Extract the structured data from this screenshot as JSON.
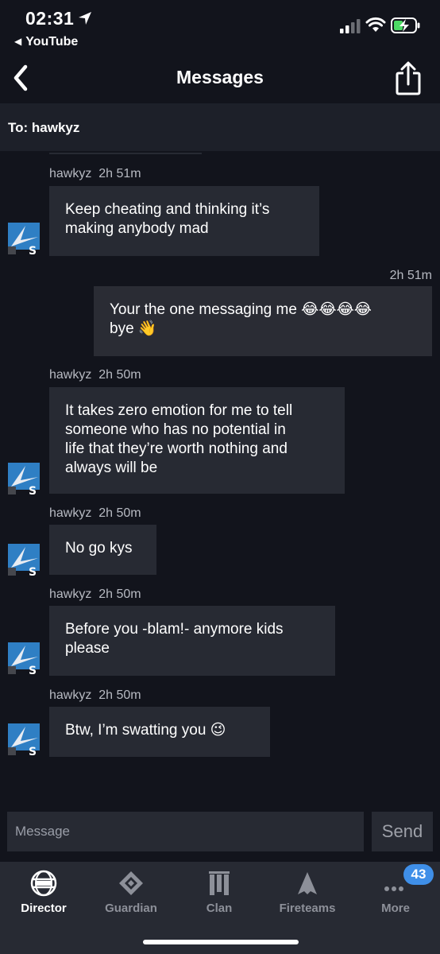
{
  "status_bar": {
    "time": "02:31",
    "back_app": "YouTube",
    "back_glyph": "◀"
  },
  "navbar": {
    "title": "Messages",
    "back_icon": "chevron-left-icon",
    "share_icon": "share-icon"
  },
  "recipient": {
    "label": "To: hawkyz"
  },
  "messages": [
    {
      "sender": "hawkyz",
      "time": "2h 51m",
      "text": "Keep cheating and thinking it’s\nmaking anybody mad",
      "mine": false
    },
    {
      "sender": "",
      "time": "2h 51m",
      "text": "Your the one messaging me 😂😂😂😂\nbye 👋",
      "mine": true
    },
    {
      "sender": "hawkyz",
      "time": "2h 50m",
      "text": "It takes zero emotion for me to tell\nsomeone who has no potential in\nlife that they’re worth nothing and\nalways will be",
      "mine": false
    },
    {
      "sender": "hawkyz",
      "time": "2h 50m",
      "text": "No go kys",
      "mine": false
    },
    {
      "sender": "hawkyz",
      "time": "2h 50m",
      "text": "Before you -blam!- anymore kids\nplease",
      "mine": false
    },
    {
      "sender": "hawkyz",
      "time": "2h 50m",
      "text": "Btw, I’m swatting you 😉",
      "mine": false
    }
  ],
  "composer": {
    "placeholder": "Message",
    "send_label": "Send"
  },
  "tabbar": {
    "tabs": [
      {
        "label": "Director",
        "icon": "director-globe-icon",
        "active": true
      },
      {
        "label": "Guardian",
        "icon": "guardian-diamond-icon",
        "active": false
      },
      {
        "label": "Clan",
        "icon": "clan-banner-icon",
        "active": false
      },
      {
        "label": "Fireteams",
        "icon": "fireteams-ship-icon",
        "active": false
      },
      {
        "label": "More",
        "icon": "more-dots-icon",
        "active": false
      }
    ],
    "more_badge": "43"
  },
  "colors": {
    "background": "#12141c",
    "bubble": "#272a33",
    "badge": "#3f8fe8",
    "battery_charging": "#4cd964"
  }
}
